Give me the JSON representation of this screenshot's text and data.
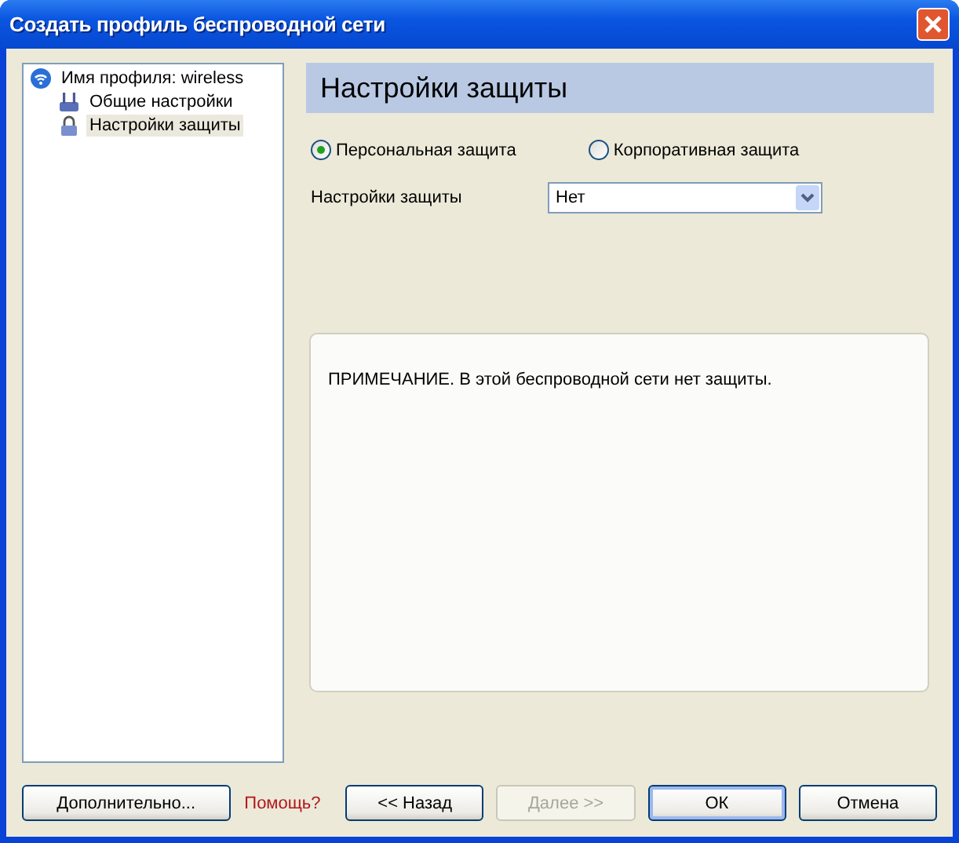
{
  "window": {
    "title": "Создать профиль беспроводной сети"
  },
  "tree": [
    {
      "label": "Имя профиля: wireless",
      "kind": "wireless",
      "selected": false,
      "children": [
        {
          "label": "Общие настройки",
          "kind": "network",
          "selected": false
        },
        {
          "label": "Настройки защиты",
          "kind": "lock",
          "selected": true
        }
      ]
    }
  ],
  "panel": {
    "heading": "Настройки защиты",
    "radios": [
      {
        "label": "Персональная защита",
        "selected": true
      },
      {
        "label": "Корпоративная защита",
        "selected": false
      }
    ],
    "security_label": "Настройки защиты",
    "security_value": "Нет",
    "note": "ПРИМЕЧАНИЕ. В этой беспроводной сети нет защиты."
  },
  "advanced_button": "Дополнительно...",
  "help_link": "Помощь?",
  "buttons": [
    {
      "label": "<< Назад",
      "disabled": false,
      "default": false
    },
    {
      "label": "Далее >>",
      "disabled": true,
      "default": false
    },
    {
      "label": "ОК",
      "disabled": false,
      "default": true
    },
    {
      "label": "Отмена",
      "disabled": false,
      "default": false
    }
  ]
}
